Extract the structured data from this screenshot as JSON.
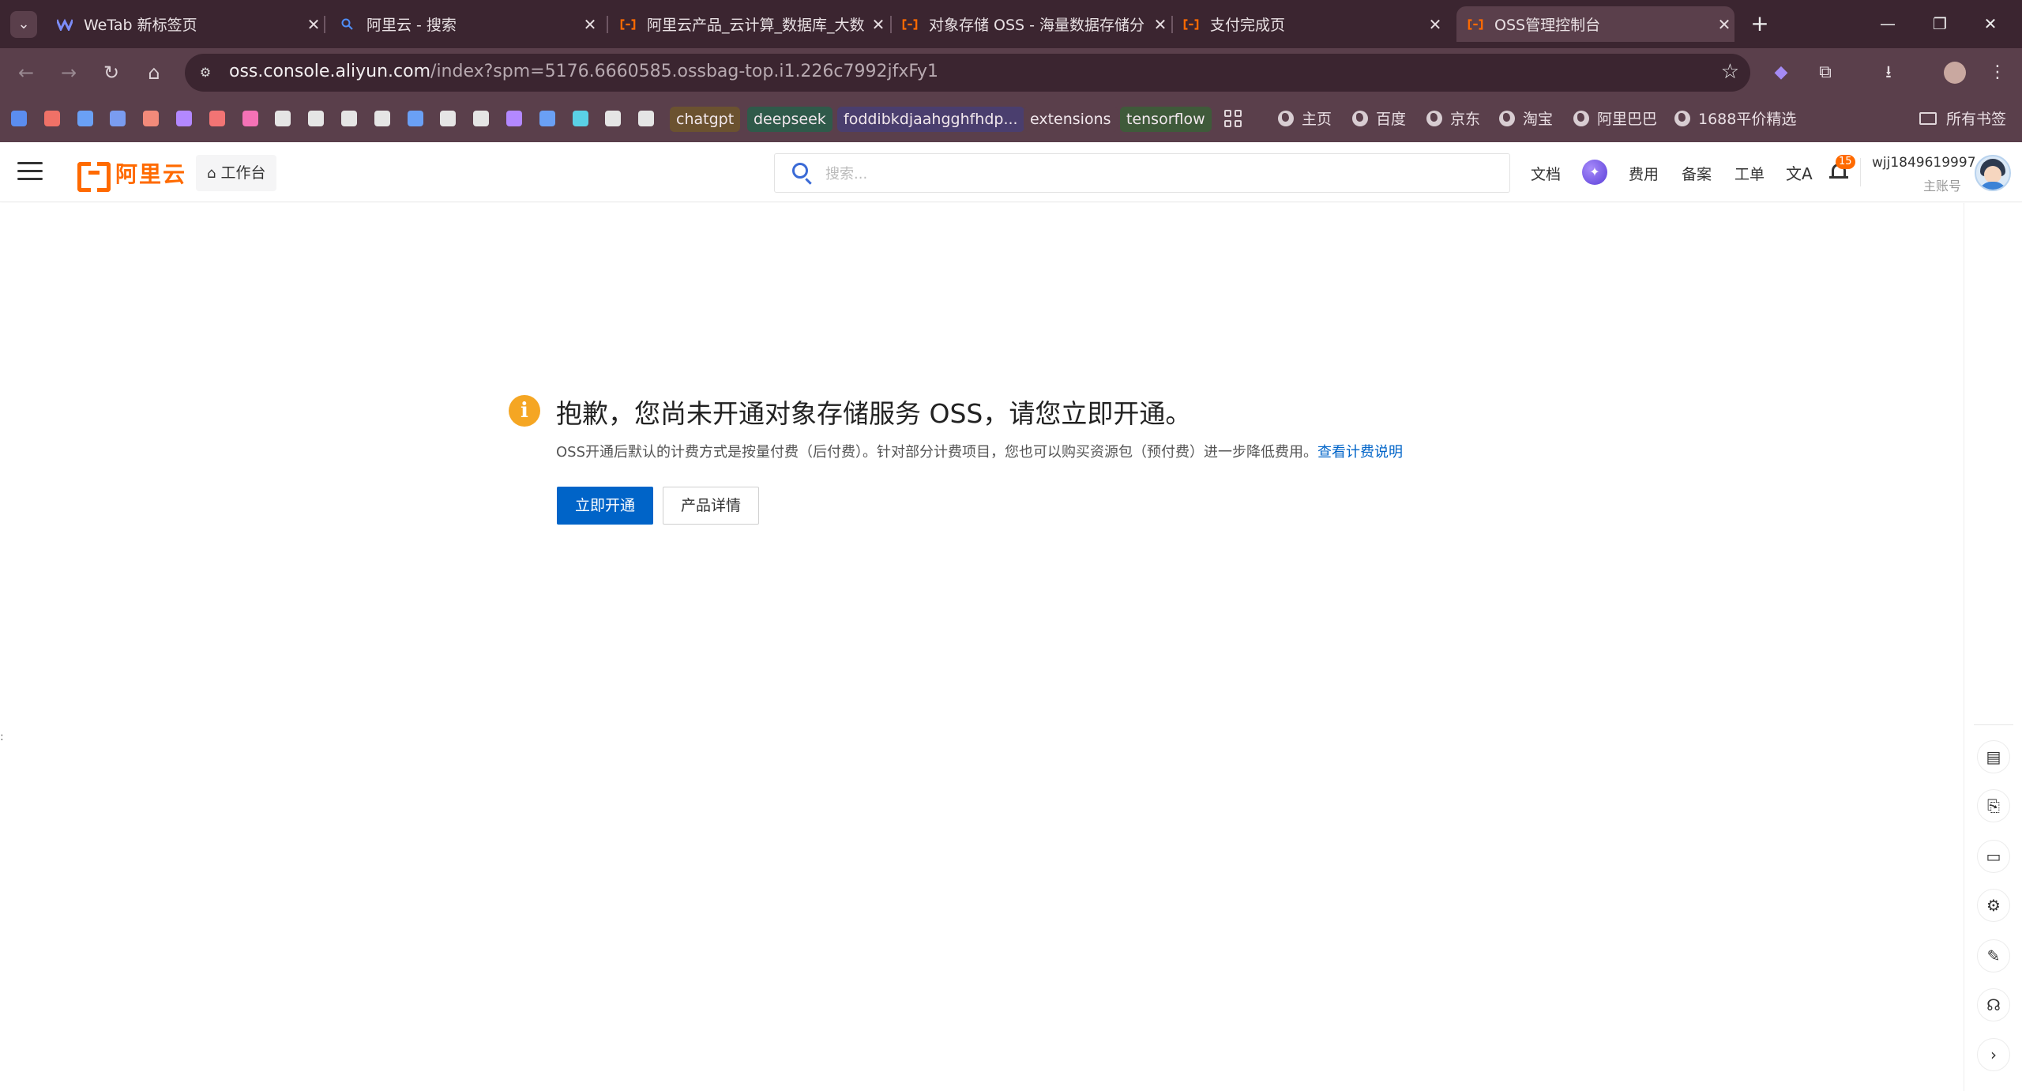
{
  "browser": {
    "tabs": [
      {
        "title": "WeTab 新标签页",
        "icon": "wetab-icon"
      },
      {
        "title": "阿里云 - 搜索",
        "icon": "search-icon"
      },
      {
        "title": "阿里云产品_云计算_数据库_大数",
        "icon": "aliyun-icon"
      },
      {
        "title": "对象存储 OSS - 海量数据存储分",
        "icon": "aliyun-icon"
      },
      {
        "title": "支付完成页",
        "icon": "aliyun-icon"
      },
      {
        "title": "OSS管理控制台",
        "icon": "aliyun-icon",
        "active": true
      }
    ],
    "new_tab_label": "+",
    "address": {
      "host": "oss.console.aliyun.com",
      "path": "/index?spm=5176.6660585.ossbag-top.i1.226c7992jfxFy1"
    },
    "bookmarks": {
      "labels": [
        "chatgpt",
        "deepseek",
        "foddibkdjaahgghfhdp...",
        "extensions",
        "tensorflow"
      ],
      "label_colors": [
        "#6b5230",
        "#2f5a4a",
        "#4a3e6e",
        "#5a3f4b",
        "#3f5a3a"
      ],
      "squares": [
        "#5b8def",
        "#f07167",
        "#6aa0f5",
        "#7a9cf0",
        "#f28a7a",
        "#b388ff",
        "#f27474",
        "#f472b6",
        "#e5e5e5",
        "#e5e5e5",
        "#e5e5e5",
        "#e5e5e5",
        "#6aa0f5",
        "#e5e5e5",
        "#e5e5e5",
        "#b388ff",
        "#6aa0f5",
        "#5ad1e6",
        "#e5e5e5",
        "#e5e5e5"
      ],
      "sites": [
        "主页",
        "百度",
        "京东",
        "淘宝",
        "阿里巴巴",
        "1688平价精选"
      ],
      "all_bookmarks": "所有书签"
    }
  },
  "header": {
    "logo_text": "阿里云",
    "workbench": "工作台",
    "search_placeholder": "搜索...",
    "docs": "文档",
    "billing": "费用",
    "icp": "备案",
    "ticket": "工单",
    "notification_count": "15",
    "username": "wjj1849619997",
    "account_type": "主账号"
  },
  "notice": {
    "title": "抱歉，您尚未开通对象存储服务 OSS，请您立即开通。",
    "description": "OSS开通后默认的计费方式是按量付费（后付费）。针对部分计费项目，您也可以购买资源包（预付费）进一步降低费用。",
    "link_text": "查看计费说明",
    "primary_button": "立即开通",
    "secondary_button": "产品详情"
  },
  "colors": {
    "brand": "#ff6a00",
    "primary": "#0064c8",
    "warning": "#f5a623"
  }
}
